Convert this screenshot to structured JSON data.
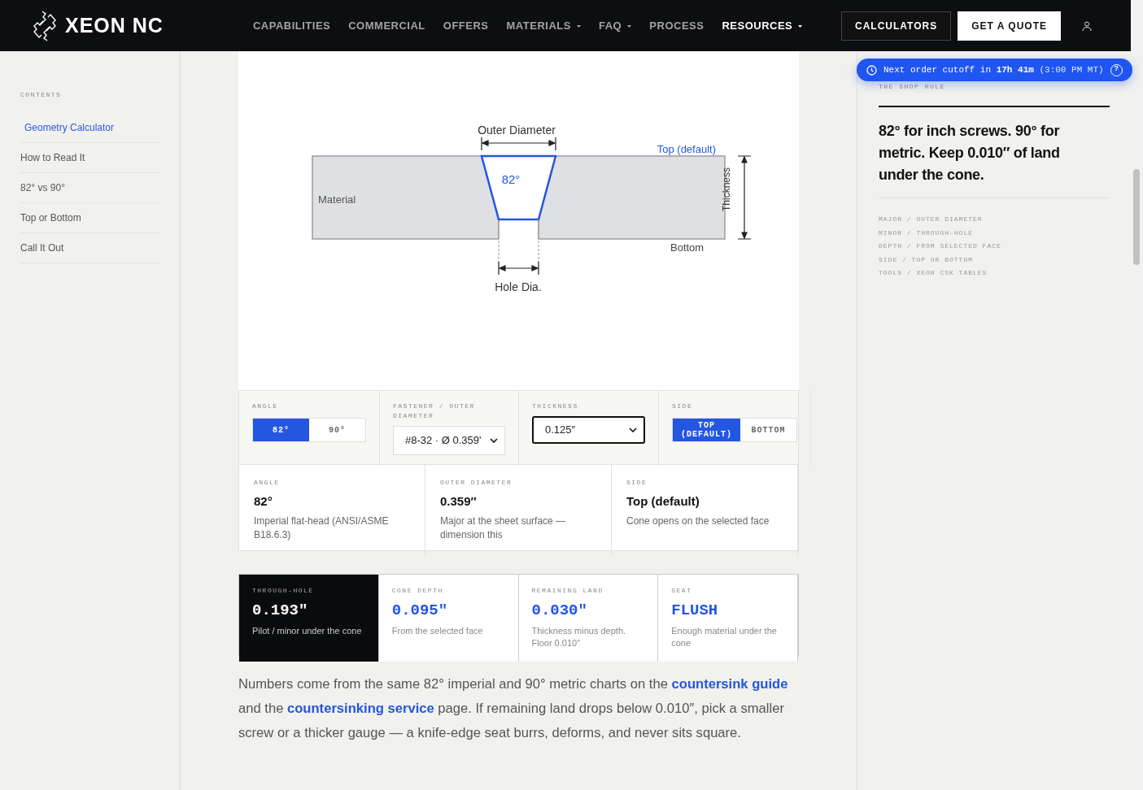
{
  "brand": {
    "name": "XEON NC"
  },
  "nav": [
    {
      "label": "CAPABILITIES",
      "dropdown": false,
      "selected": false
    },
    {
      "label": "COMMERCIAL",
      "dropdown": false,
      "selected": false
    },
    {
      "label": "OFFERS",
      "dropdown": false,
      "selected": false
    },
    {
      "label": "MATERIALS",
      "dropdown": true,
      "selected": false
    },
    {
      "label": "FAQ",
      "dropdown": true,
      "selected": false
    },
    {
      "label": "PROCESS",
      "dropdown": false,
      "selected": false
    },
    {
      "label": "RESOURCES",
      "dropdown": true,
      "selected": true
    }
  ],
  "nav_buttons": [
    {
      "label": "CALCULATORS",
      "kind": "outline"
    },
    {
      "label": "GET A QUOTE",
      "kind": "solid"
    }
  ],
  "contents": {
    "title": "CONTENTS",
    "items": [
      {
        "label": "Geometry Calculator",
        "selected": true
      },
      {
        "label": "How to Read It",
        "selected": false
      },
      {
        "label": "82° vs 90°",
        "selected": false
      },
      {
        "label": "Top or Bottom",
        "selected": false
      },
      {
        "label": "Call It Out",
        "selected": false
      }
    ]
  },
  "diagram": {
    "outer_diameter": "Outer Diameter",
    "side": "Top (default)",
    "angle": "82°",
    "material": "Material",
    "thickness": "Thickness",
    "bottom": "Bottom",
    "hole": "Hole Dia."
  },
  "controls": [
    {
      "kind": "segmented",
      "label": "ANGLE",
      "options": [
        {
          "label": "82°",
          "selected": true
        },
        {
          "label": "90°",
          "selected": false
        }
      ]
    },
    {
      "kind": "select",
      "label": "FASTENER / OUTER DIAMETER",
      "value": "#8-32 · Ø 0.359'",
      "focused": false
    },
    {
      "kind": "select",
      "label": "THICKNESS",
      "value": "0.125″",
      "focused": true
    },
    {
      "kind": "segmented",
      "label": "SIDE",
      "options": [
        {
          "label": "TOP (DEFAULT)",
          "selected": true
        },
        {
          "label": "BOTTOM",
          "selected": false
        }
      ]
    }
  ],
  "summary": [
    {
      "label": "ANGLE",
      "value": "82°",
      "note": "Imperial flat-head (ANSI/ASME B18.6.3)"
    },
    {
      "label": "OUTER DIAMETER",
      "value": "0.359″",
      "note": "Major at the sheet surface — dimension this"
    },
    {
      "label": "SIDE",
      "value": "Top (default)",
      "note": "Cone opens on the selected face"
    }
  ],
  "results": [
    {
      "kind": "dark",
      "label": "THROUGH-HOLE",
      "value": "0.193″",
      "note": "Pilot / minor under the cone"
    },
    {
      "kind": "light",
      "label": "CONE DEPTH",
      "value": "0.095″",
      "note": "From the selected face"
    },
    {
      "kind": "light",
      "label": "REMAINING LAND",
      "value": "0.030″",
      "note": "Thickness minus depth. Floor 0.010″"
    },
    {
      "kind": "light",
      "label": "SEAT",
      "value": "FLUSH",
      "note": "Enough material under the cone"
    }
  ],
  "paragraph": [
    {
      "kind": "text",
      "text": "Numbers come from the same 82° imperial and 90° metric charts on the "
    },
    {
      "kind": "link",
      "text": "countersink guide"
    },
    {
      "kind": "text",
      "text": " and the "
    },
    {
      "kind": "link",
      "text": "countersinking service"
    },
    {
      "kind": "text",
      "text": " page. If remaining land drops below 0.010″, pick a smaller screw or a thicker gauge — a knife-edge seat burrs, deforms, and never sits square."
    }
  ],
  "cutoff": {
    "prefix": "Next order cutoff in ",
    "time": "17h 41m",
    "suffix": " (3:00 PM MT)",
    "help": "?"
  },
  "shop_rule": {
    "title": "THE SHOP RULE",
    "headline": "82° for inch screws. 90° for metric. Keep 0.010″ of land under the cone.",
    "terms": [
      "MAJOR / OUTER DIAMETER",
      "MINOR / THROUGH-HOLE",
      "DEPTH / FROM SELECTED FACE",
      "SIDE / TOP OR BOTTOM",
      "TOOLS / XEON CSK TABLES"
    ]
  }
}
